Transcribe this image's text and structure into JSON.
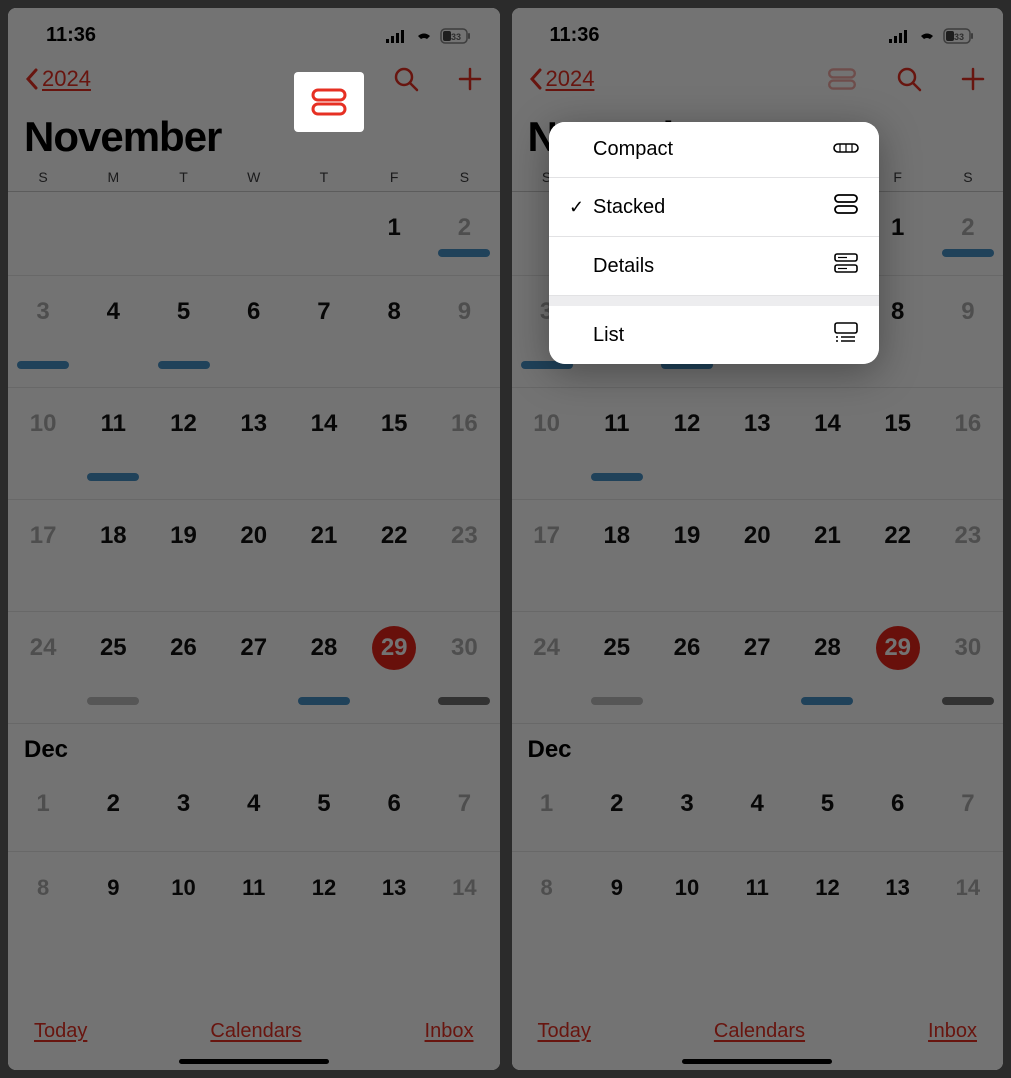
{
  "status": {
    "time": "11:36",
    "battery": "33"
  },
  "nav": {
    "year": "2024"
  },
  "month_title": "November",
  "weekdays": [
    "S",
    "M",
    "T",
    "W",
    "T",
    "F",
    "S"
  ],
  "nov_weeks": [
    [
      {
        "d": ""
      },
      {
        "d": ""
      },
      {
        "d": ""
      },
      {
        "d": ""
      },
      {
        "d": ""
      },
      {
        "d": "1"
      },
      {
        "d": "2",
        "gray": true,
        "ev": "blue"
      }
    ],
    [
      {
        "d": "3",
        "gray": true,
        "ev": "blue"
      },
      {
        "d": "4"
      },
      {
        "d": "5",
        "ev": "blue"
      },
      {
        "d": "6"
      },
      {
        "d": "7"
      },
      {
        "d": "8"
      },
      {
        "d": "9",
        "gray": true
      }
    ],
    [
      {
        "d": "10",
        "gray": true
      },
      {
        "d": "11",
        "ev": "blue"
      },
      {
        "d": "12"
      },
      {
        "d": "13"
      },
      {
        "d": "14"
      },
      {
        "d": "15"
      },
      {
        "d": "16",
        "gray": true
      }
    ],
    [
      {
        "d": "17",
        "gray": true
      },
      {
        "d": "18"
      },
      {
        "d": "19"
      },
      {
        "d": "20"
      },
      {
        "d": "21"
      },
      {
        "d": "22"
      },
      {
        "d": "23",
        "gray": true
      }
    ],
    [
      {
        "d": "24",
        "gray": true
      },
      {
        "d": "25",
        "ev": "gray"
      },
      {
        "d": "26"
      },
      {
        "d": "27"
      },
      {
        "d": "28",
        "ev": "blue"
      },
      {
        "d": "29",
        "today": true
      },
      {
        "d": "30",
        "gray": true,
        "ev": "dark"
      }
    ]
  ],
  "next_month": "Dec",
  "dec_weeks": [
    [
      {
        "d": "1",
        "gray": true
      },
      {
        "d": "2"
      },
      {
        "d": "3"
      },
      {
        "d": "4"
      },
      {
        "d": "5"
      },
      {
        "d": "6"
      },
      {
        "d": "7",
        "gray": true
      }
    ],
    [
      {
        "d": "8",
        "gray": true
      },
      {
        "d": "9"
      },
      {
        "d": "10"
      },
      {
        "d": "11"
      },
      {
        "d": "12"
      },
      {
        "d": "13"
      },
      {
        "d": "14",
        "gray": true
      }
    ]
  ],
  "toolbar": {
    "today": "Today",
    "calendars": "Calendars",
    "inbox": "Inbox"
  },
  "menu": {
    "compact": "Compact",
    "stacked": "Stacked",
    "details": "Details",
    "list": "List"
  }
}
